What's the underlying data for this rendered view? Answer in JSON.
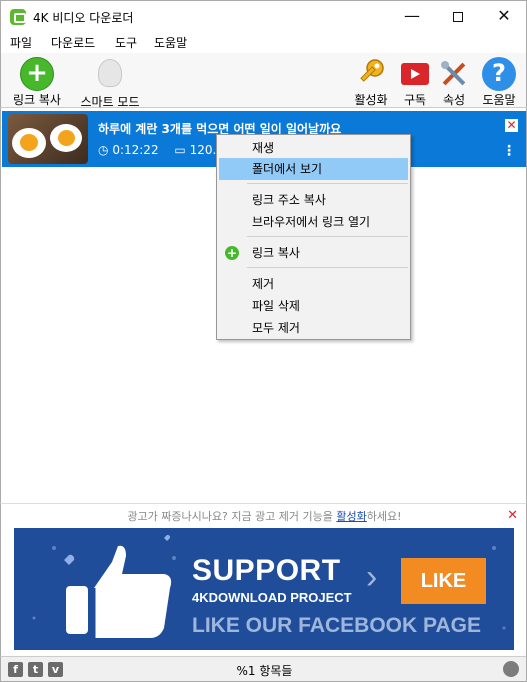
{
  "window": {
    "title": "4K 비디오 다운로더",
    "controls": {
      "minimize": "—",
      "maximize": "□",
      "close": "✕"
    }
  },
  "menu": [
    "파일",
    "다운로드",
    "도구",
    "도움말"
  ],
  "toolbar": {
    "paste_link": "링크 복사",
    "smart_mode": "스마트 모드",
    "activate": "활성화",
    "subscribe": "구독",
    "settings": "속성",
    "help": "도움말"
  },
  "download": {
    "title": "하루에 계란 3개를 먹으면 어떤 일이 일어날까요",
    "duration": "0:12:22",
    "size": "120.7"
  },
  "context_menu": {
    "play": "재생",
    "show_in_folder": "폴더에서 보기",
    "copy_link_address": "링크 주소 복사",
    "open_link_in_browser": "브라우저에서 링크 열기",
    "paste_link": "링크 복사",
    "remove": "제거",
    "delete_file": "파일 삭제",
    "remove_all": "모두 제거"
  },
  "ad": {
    "text_before": "광고가 짜증나시나요? 지금 광고 제거 기능을",
    "link": "활성화",
    "text_after": "하세요!",
    "banner": {
      "support": "SUPPORT",
      "project": "4KDOWNLOAD PROJECT",
      "like": "LIKE",
      "facebook": "LIKE OUR FACEBOOK PAGE"
    }
  },
  "status": {
    "items": "%1 항목들"
  },
  "colors": {
    "selection": "#0a79d8",
    "menu_highlight": "#91c9f7",
    "banner_bg": "#1f4d9a",
    "like_button": "#f28b22",
    "green_icon": "#47b82c"
  }
}
